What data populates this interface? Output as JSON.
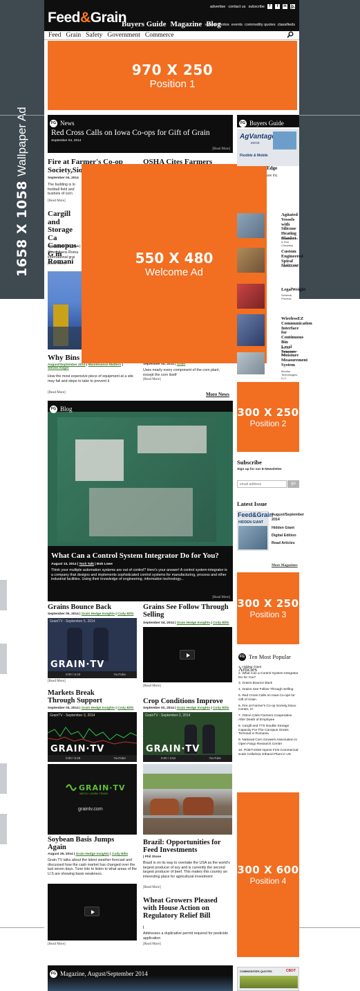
{
  "wallpaper_label": {
    "size": "1658 X 1058",
    "name": "Wallpaper Ad"
  },
  "header": {
    "logo_a": "Feed",
    "logo_amp": "&",
    "logo_b": "Grain",
    "main_nav": [
      "Buyers Guide",
      "Magazine",
      "Blog"
    ],
    "util_nav": [
      "advertise",
      "contact us",
      "subscribe"
    ],
    "social": [
      "f",
      "t",
      "in",
      "rss"
    ],
    "sub_links": [
      "videos",
      "photos",
      "events",
      "commodity quotes",
      "classifieds"
    ],
    "categories": [
      "Feed",
      "Grain",
      "Safety",
      "Government",
      "Commerce"
    ]
  },
  "ads": {
    "top": {
      "size": "970 X 250",
      "pos": "Position 1"
    },
    "welcome": {
      "size": "550 X 480",
      "pos": "Welcome Ad"
    },
    "p2": {
      "size": "300 X 250",
      "pos": "Position 2"
    },
    "p3": {
      "size": "300 X 250",
      "pos": "Position 3"
    },
    "p4": {
      "size": "300 X 600",
      "pos": "Position 4"
    }
  },
  "news": {
    "section": "News",
    "featured_title": "Red Cross Calls on Iowa Co-ops for Gift of Grain",
    "featured_date": "September 04, 2014",
    "read_more": "[Read More]",
    "a1_title": "Fire at Farmer's Co-op Society,Sio",
    "a1_date": "September 04, 2014",
    "a1_body": "The building is lo football field and bushels of corn",
    "a2_title": "OSHA Cites Farmers",
    "a3_title": "Cargill and Storage Ca Canopus G in Romani",
    "a3_date": "September 04, 2014 | C",
    "a3_body": "Strengthens Roma international grai",
    "a4_title": "Why Bins F",
    "a4_meta_date": "August/September 2014",
    "a4_meta_cat": "Maintenance Matters",
    "a4_meta_author": "Steven Kilger",
    "a4_body": "How the most expensive piece of equipment at a site may fail and steps to take to prevent it",
    "a5_date": "September 04, 2014",
    "a5_link": "Grain",
    "a5_body": "Uses nearly every component of the corn plant, except the corn itself",
    "more_news": "More News"
  },
  "blog": {
    "section": "Blog",
    "title": "What Can a Control System Integrator Do for You?",
    "date": "August 13, 2014",
    "cat": "Tech Talk",
    "author": "Bob Lowe",
    "body": "Think your multiple automation systems are out of control? Here's your answer! A control system integrator is a company that designs and implements sophisticated control systems for manufacturing, process and other industrial facilities. Using their knowledge of engineering, information technology...",
    "read_more": "[Read More]"
  },
  "videos": {
    "v1_title": "Grains Bounce Back",
    "v1_date": "September 05, 2014",
    "v1_cat": "Grain Hedge Insights",
    "v1_author": "Cody Bills",
    "v1_player": "GrainTV - September 5, 2014",
    "v1_time": "0:00 / 6:43",
    "v2_title": "Grains See Follow Through Selling",
    "v2_date": "September 04, 2014",
    "v2_cat": "Grain Hedge Insights",
    "v2_author": "Cody Bills",
    "v3_title": "Markets Break Through Support",
    "v3_date": "September 03, 2014",
    "v3_cat": "Grain Hedge Insights",
    "v3_author": "Cody Bills",
    "v3_player": "GrainTV - September 3, 2014",
    "v3_time": "0:00 / 5:29",
    "v4_title": "Crop Conditions Improve",
    "v4_date": "September 02, 2014",
    "v4_cat": "Grain Hedge Insights",
    "v4_author": "Cody Bills",
    "v4_player": "GrainTV - September 2, 2014",
    "v4_time": "0:00 / 3:52",
    "graintv": "GRAIN·TV",
    "graintv_logo": "GRAIN·TV",
    "graintv_tag": "WATCH. LEARN. TRADE.",
    "graintv_url": "graintv.com",
    "yt": "YouTube",
    "read_more": "[Read More]",
    "v5_title": "Soybean Basis Jumps Again",
    "v5_date": "August 29, 2014",
    "v5_cat": "Grain Hedge Insights",
    "v5_author": "Cody Bills",
    "v5_body": "Grain TV talks about the latest weather forecast and discussed how the cash market has changed over the last seven days. Tune into to listen to what areas of the U.S are showing basis weakness.",
    "b_title": "Brazil: Opportunities for Feed Investments",
    "b_meta": "| Phil Stone",
    "b_body": "Brazil is on its way to overtake the USA as the world's largest producer of soy and is currently the second largest producer of beef. This makes this country an interesting place for agricultural investment",
    "w_title": "Wheat Growers Pleased with House Action on Regulatory Relief Bill",
    "w_meta": "|",
    "w_body": "Addresses a duplicative permit required for pesticide application"
  },
  "magazine_bar": "Magazine, August/September 2014",
  "sidebar": {
    "buyers_guide": "Buyers Guide",
    "agvantage_a": "AgVantage",
    "agvantage_b": "EDGE",
    "agvantage_sub": "Flexible & Mobile",
    "edge_partial": "Edge",
    "edge_co": "are Inc.",
    "items": [
      {
        "title": "Agitated Vessels with Silicone Heating Blanket",
        "co": "Charles Ross & Son Company"
      },
      {
        "title": "Custom Engineered Spiral Staircase",
        "co": "Hoffmann Inc."
      },
      {
        "title": "LegalWeight",
        "co": "Schenck Process"
      },
      {
        "title": "WirelessEZ Communication Interface for Continuous Bin Level Sensors",
        "co": "Monitor Technologies LLC"
      },
      {
        "title": "Moisture Measurement System",
        "co": "Monitor Technologies LLC"
      }
    ],
    "subscribe_title": "Subscribe",
    "subscribe_sub": "Sign up for our E-Newsletter",
    "email_placeholder": "email address",
    "go": "go",
    "latest_issue": "Latest Issue",
    "issue_date": "August/September 2014",
    "issue_links": [
      "Hidden Giant",
      "Digital Edition",
      "Read Articles"
    ],
    "issue_cover_logo": "Feed&Grain",
    "issue_cover_headline": "HIDDEN GIANT",
    "more_magazines": "More Magazines",
    "popular_title": "Ten Most Popular Articles",
    "popular": [
      "1. Hidden Giant",
      "2. What Can a Control System Integrator Do for You?",
      "3. Grains Bounce Back",
      "4. Grains See Follow Through Selling",
      "5. Red Cross Calls on Iowa Co-ops for Gift of Grain",
      "6. Fire at Farmer's Co-op Society,Sioux Center, IA",
      "7. OSHA Cites Farmers Cooperative After Death of Employee",
      "8. Cargill and TTS Double Storage Capacity For The Canopus Grains Terminal in Romania",
      "9. National Corn Growers Association to Open Fargo Research Center",
      "10. POET-DSM Opens First Commercial-scale Cellulosic Ethanol Plant in US"
    ],
    "commodities_label": "COMMODITIES QUOTES",
    "cbot": "CBOT"
  },
  "colors": {
    "orange": "#f26e21",
    "black": "#0e0e0e",
    "wallpaper": "#3e4950",
    "link_green": "#3a7a2a"
  }
}
